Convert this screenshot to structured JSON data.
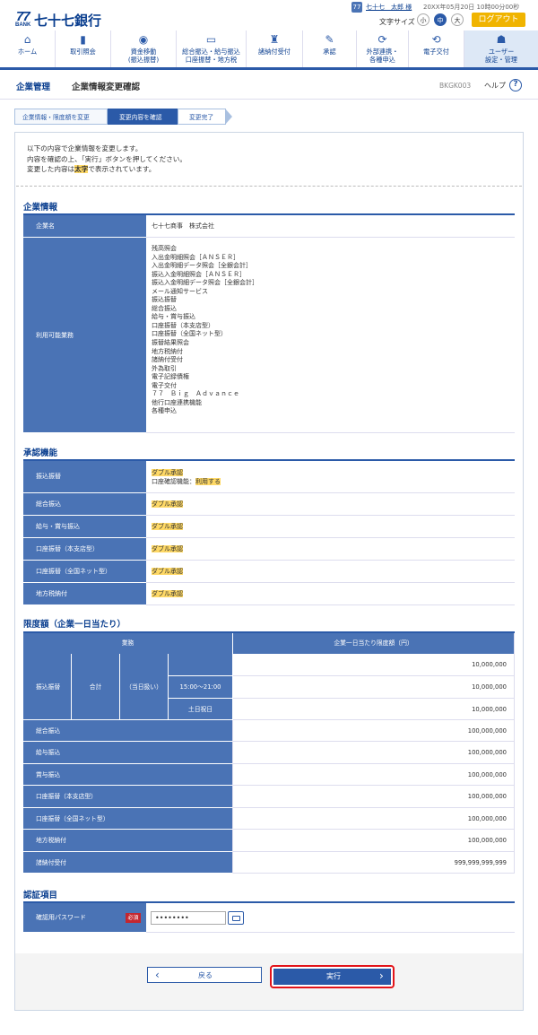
{
  "header": {
    "logo_number": "77",
    "logo_bank": "BANK",
    "bank_name": "七十七銀行",
    "user_icon": "77",
    "user_name": "七十七　太郎 様",
    "last_login": "20XX年05月20日 10時00分00秒",
    "font_size_label": "文字サイズ",
    "font_sizes": [
      "小",
      "中",
      "大"
    ],
    "logout_label": "ログアウト"
  },
  "nav": [
    {
      "icon": "home-icon",
      "glyph": "⌂",
      "label": "ホーム"
    },
    {
      "icon": "document-icon",
      "glyph": "▮",
      "label": "取引照会"
    },
    {
      "icon": "yen-transfer-icon",
      "glyph": "◉",
      "label": "資金移動\n(振込振替)"
    },
    {
      "icon": "card-icon",
      "glyph": "▭",
      "label": "総合振込・給与振込\n口座振替・地方税"
    },
    {
      "icon": "tax-icon",
      "glyph": "♜",
      "label": "諸納付受付"
    },
    {
      "icon": "approve-icon",
      "glyph": "✎",
      "label": "承認"
    },
    {
      "icon": "link-icon",
      "glyph": "⟳",
      "label": "外部連携・\n各種申込"
    },
    {
      "icon": "electronic-icon",
      "glyph": "⟲",
      "label": "電子交付"
    },
    {
      "icon": "user-settings-icon",
      "glyph": "☗",
      "label": "ユーザー\n設定・管理"
    }
  ],
  "bar": {
    "section": "企業管理",
    "title": "企業情報変更確認",
    "code": "BKGK003",
    "help": "ヘルプ",
    "help_icon": "?"
  },
  "steps": [
    "企業情報・限度額を変更",
    "変更内容を確認",
    "変更完了"
  ],
  "intro": {
    "line1": "以下の内容で企業情報を変更します。",
    "line2": "内容を確認の上、「実行」ボタンを押してください。",
    "line3a": "変更した内容は",
    "line3b": "太字",
    "line3c": "で表示されています。"
  },
  "company": {
    "heading": "企業情報",
    "name_label": "企業名",
    "name_value": "七十七商事　株式会社",
    "services_label": "利用可能業務",
    "services": [
      "残高照会",
      "入出金明細照会［ＡＮＳＥＲ］",
      "入出金明細データ照会［全銀会計］",
      "振込入金明細照会［ＡＮＳＥＲ］",
      "振込入金明細データ照会［全銀会計］",
      "メール通知サービス",
      "振込振替",
      "総合振込",
      "給与・賞与振込",
      "口座振替（本支店型）",
      "口座振替（全国ネット型）",
      "振替結果照会",
      "地方税納付",
      "諸納付受付",
      "外為取引",
      "電子記録債権",
      "電子交付",
      "７７　Ｂｉｇ　Ａｄｖａｎｃｅ",
      "他行口座連携機能",
      "各種申込"
    ]
  },
  "approval": {
    "heading": "承認機能",
    "rows": [
      {
        "label": "振込振替",
        "value": "ダブル承認",
        "sub_label": "口座確認機能：",
        "sub_value": "利用する"
      },
      {
        "label": "総合振込",
        "value": "ダブル承認"
      },
      {
        "label": "給与・賞与振込",
        "value": "ダブル承認"
      },
      {
        "label": "口座振替（本支店型）",
        "value": "ダブル承認"
      },
      {
        "label": "口座振替（全国ネット型）",
        "value": "ダブル承認"
      },
      {
        "label": "地方税納付",
        "value": "ダブル承認"
      }
    ]
  },
  "limits": {
    "heading": "限度額（企業一日当たり）",
    "col_task": "業務",
    "col_amount": "企業一日当たり限度額（円）",
    "transfer_label": "振込振替",
    "total_label": "合計",
    "same_day_label": "（当日扱い）",
    "time_label": "15:00～21:00",
    "holiday_label": "土日祝日",
    "transfer_amounts": [
      "10,000,000",
      "10,000,000",
      "10,000,000"
    ],
    "rows": [
      {
        "label": "総合振込",
        "amount": "100,000,000"
      },
      {
        "label": "給与振込",
        "amount": "100,000,000"
      },
      {
        "label": "賞与振込",
        "amount": "100,000,000"
      },
      {
        "label": "口座振替（本支店型）",
        "amount": "100,000,000"
      },
      {
        "label": "口座振替（全国ネット型）",
        "amount": "100,000,000"
      },
      {
        "label": "地方税納付",
        "amount": "100,000,000"
      },
      {
        "label": "諸納付受付",
        "amount": "999,999,999,999"
      }
    ]
  },
  "auth": {
    "heading": "認証項目",
    "password_label": "確認用パスワード",
    "required": "必須",
    "password_value": "••••••••"
  },
  "buttons": {
    "back": "戻る",
    "back_icon": "‹",
    "execute": "実行",
    "execute_icon": "›"
  }
}
